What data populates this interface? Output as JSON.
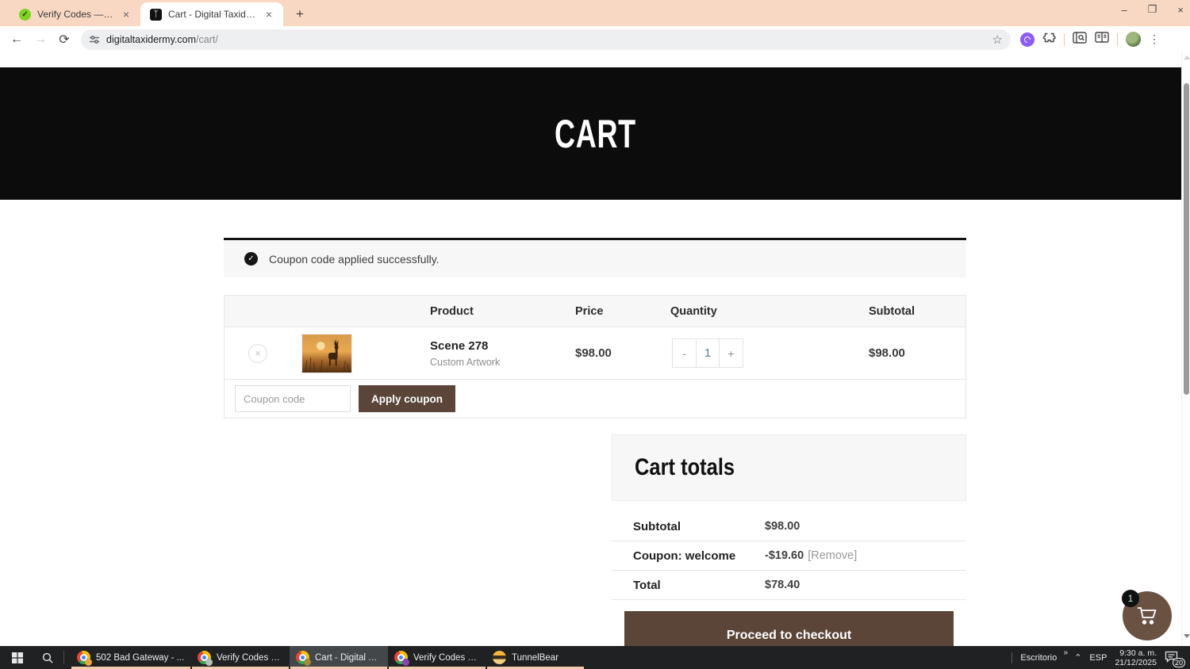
{
  "browser": {
    "tab1": {
      "title": "Verify Codes — SimplyCodes",
      "close": "×",
      "favicon_check": "✓"
    },
    "tab2": {
      "title": "Cart - Digital Taxidermy",
      "close": "×",
      "favicon_glyph": "ᛉ"
    },
    "new_tab": "+",
    "window_controls": {
      "minimize": "–",
      "restore": "❐",
      "close": "×"
    },
    "nav": {
      "back": "←",
      "forward": "→",
      "refresh": "⟳"
    },
    "url_host": "digitaltaxidermy.com",
    "url_path": "/cart/",
    "star": "☆",
    "menu": "⋮"
  },
  "page": {
    "hero_title": "CART",
    "notice_text": "Coupon code applied successfully.",
    "notice_check": "✓"
  },
  "cart_table": {
    "headers": {
      "product": "Product",
      "price": "Price",
      "quantity": "Quantity",
      "subtotal": "Subtotal"
    },
    "item": {
      "remove": "×",
      "name": "Scene 278",
      "variant": "Custom Artwork",
      "price": "$98.00",
      "qty_minus": "-",
      "qty_value": "1",
      "qty_plus": "+",
      "subtotal": "$98.00"
    },
    "coupon_placeholder": "Coupon code",
    "apply_button": "Apply coupon"
  },
  "totals": {
    "title": "Cart totals",
    "rows": [
      {
        "label": "Subtotal",
        "value": "$98.00",
        "action": ""
      },
      {
        "label": "Coupon: welcome",
        "value": "-$19.60",
        "action": "[Remove]"
      },
      {
        "label": "Total",
        "value": "$78.40",
        "action": ""
      }
    ],
    "checkout_button": "Proceed to checkout",
    "floating_cart_badge": "1"
  },
  "taskbar": {
    "apps": [
      {
        "label": "502 Bad Gateway - ..."
      },
      {
        "label": "Verify Codes — Sim..."
      },
      {
        "label": "Cart - Digital Taxide..."
      },
      {
        "label": "Verify Codes — Sim..."
      },
      {
        "label": "TunnelBear"
      }
    ],
    "tray": {
      "desktop_label": "Escritorio",
      "chevrons": "»",
      "expand": "⌃",
      "language": "ESP",
      "time": "9:30 a. m.",
      "date": "21/12/2025",
      "notification_count": "20"
    }
  },
  "colors": {
    "brand_brown": "#5a4538",
    "tab_strip_peach": "#f9d8c3",
    "hero_black": "#0c0c0c",
    "taskbar_indicator": "#f5c9ab"
  }
}
